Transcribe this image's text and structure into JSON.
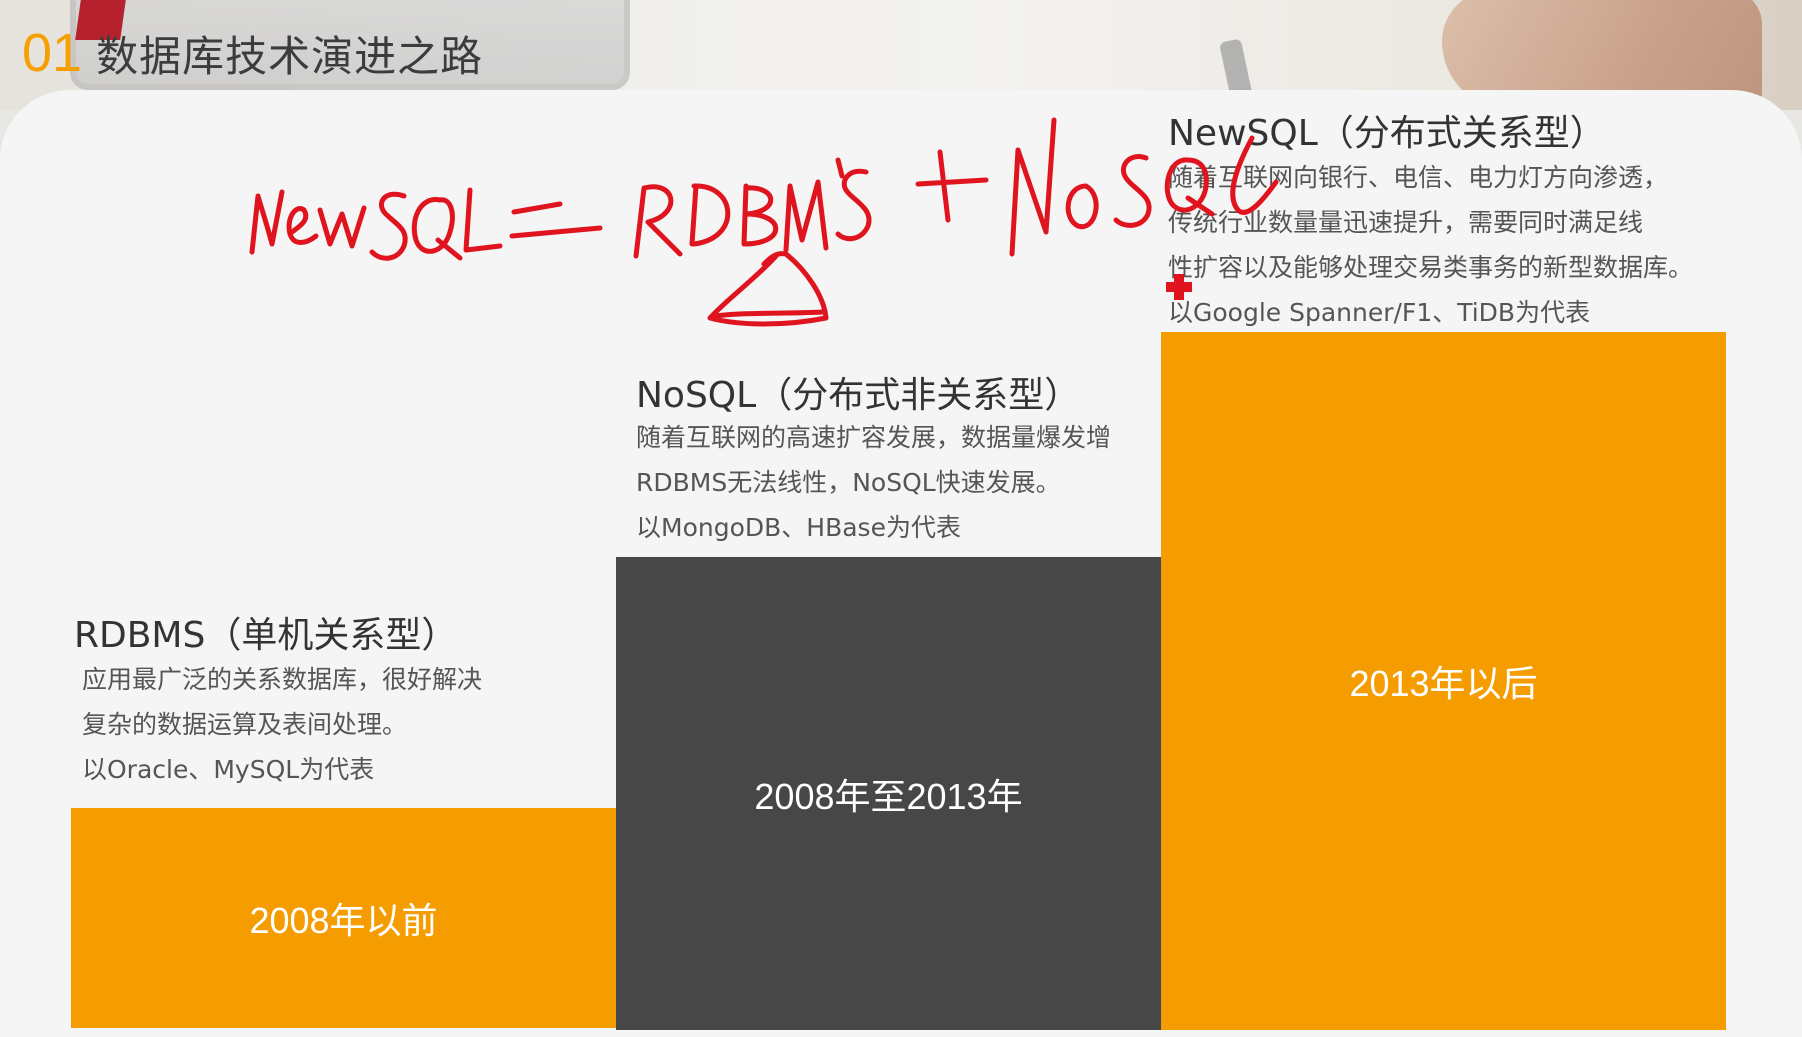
{
  "slide": {
    "number": "01",
    "title": "数据库技术演进之路"
  },
  "columns": [
    {
      "heading": "RDBMS（单机关系型）",
      "lines": [
        "应用最广泛的关系数据库，很好解决",
        "复杂的数据运算及表间处理。",
        "以Oracle、MySQL为代表"
      ],
      "period": "2008年以前",
      "color": "#f59c00"
    },
    {
      "heading": "NoSQL（分布式非关系型）",
      "lines": [
        "随着互联网的高速扩容发展，数据量爆发增",
        "RDBMS无法线性，NoSQL快速发展。",
        "以MongoDB、HBase为代表"
      ],
      "period": "2008年至2013年",
      "color": "#474747"
    },
    {
      "heading": "NewSQL（分布式关系型）",
      "lines": [
        "随着互联网向银行、电信、电力灯方向渗透，",
        "传统行业数量量迅速提升，需要同时满足线",
        "性扩容以及能够处理交易类事务的新型数据库。",
        "以Google Spanner/F1、TiDB为代表"
      ],
      "period": "2013年以后",
      "color": "#f59c00"
    }
  ],
  "annotation": {
    "handwriting": "NewSQL = RDBMS + NoSQL",
    "pen_color": "#e0141e",
    "shape": "triangle",
    "cursor": "red-cross-cursor"
  }
}
